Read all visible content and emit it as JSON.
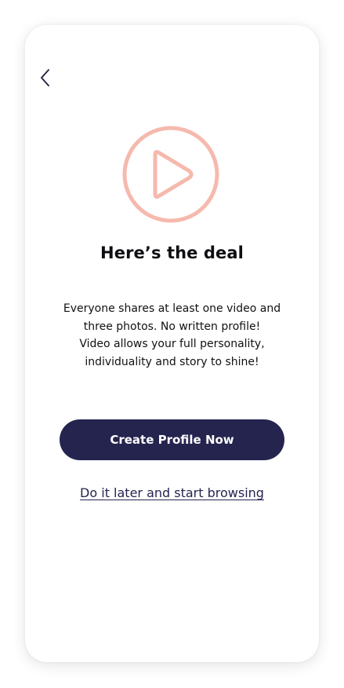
{
  "screen": {
    "back_icon": "chevron-left-icon",
    "hero_icon": "play-circle-icon",
    "accent_color": "#f6b9ad",
    "primary_color": "#25244f"
  },
  "content": {
    "title": "Here’s the deal",
    "body_lines": [
      "Everyone shares at least one video and",
      "three photos. No written profile!",
      "Video allows your full personality,",
      "individuality and story to shine!"
    ]
  },
  "actions": {
    "primary_label": "Create Profile Now",
    "secondary_label": "Do it later and start browsing"
  }
}
